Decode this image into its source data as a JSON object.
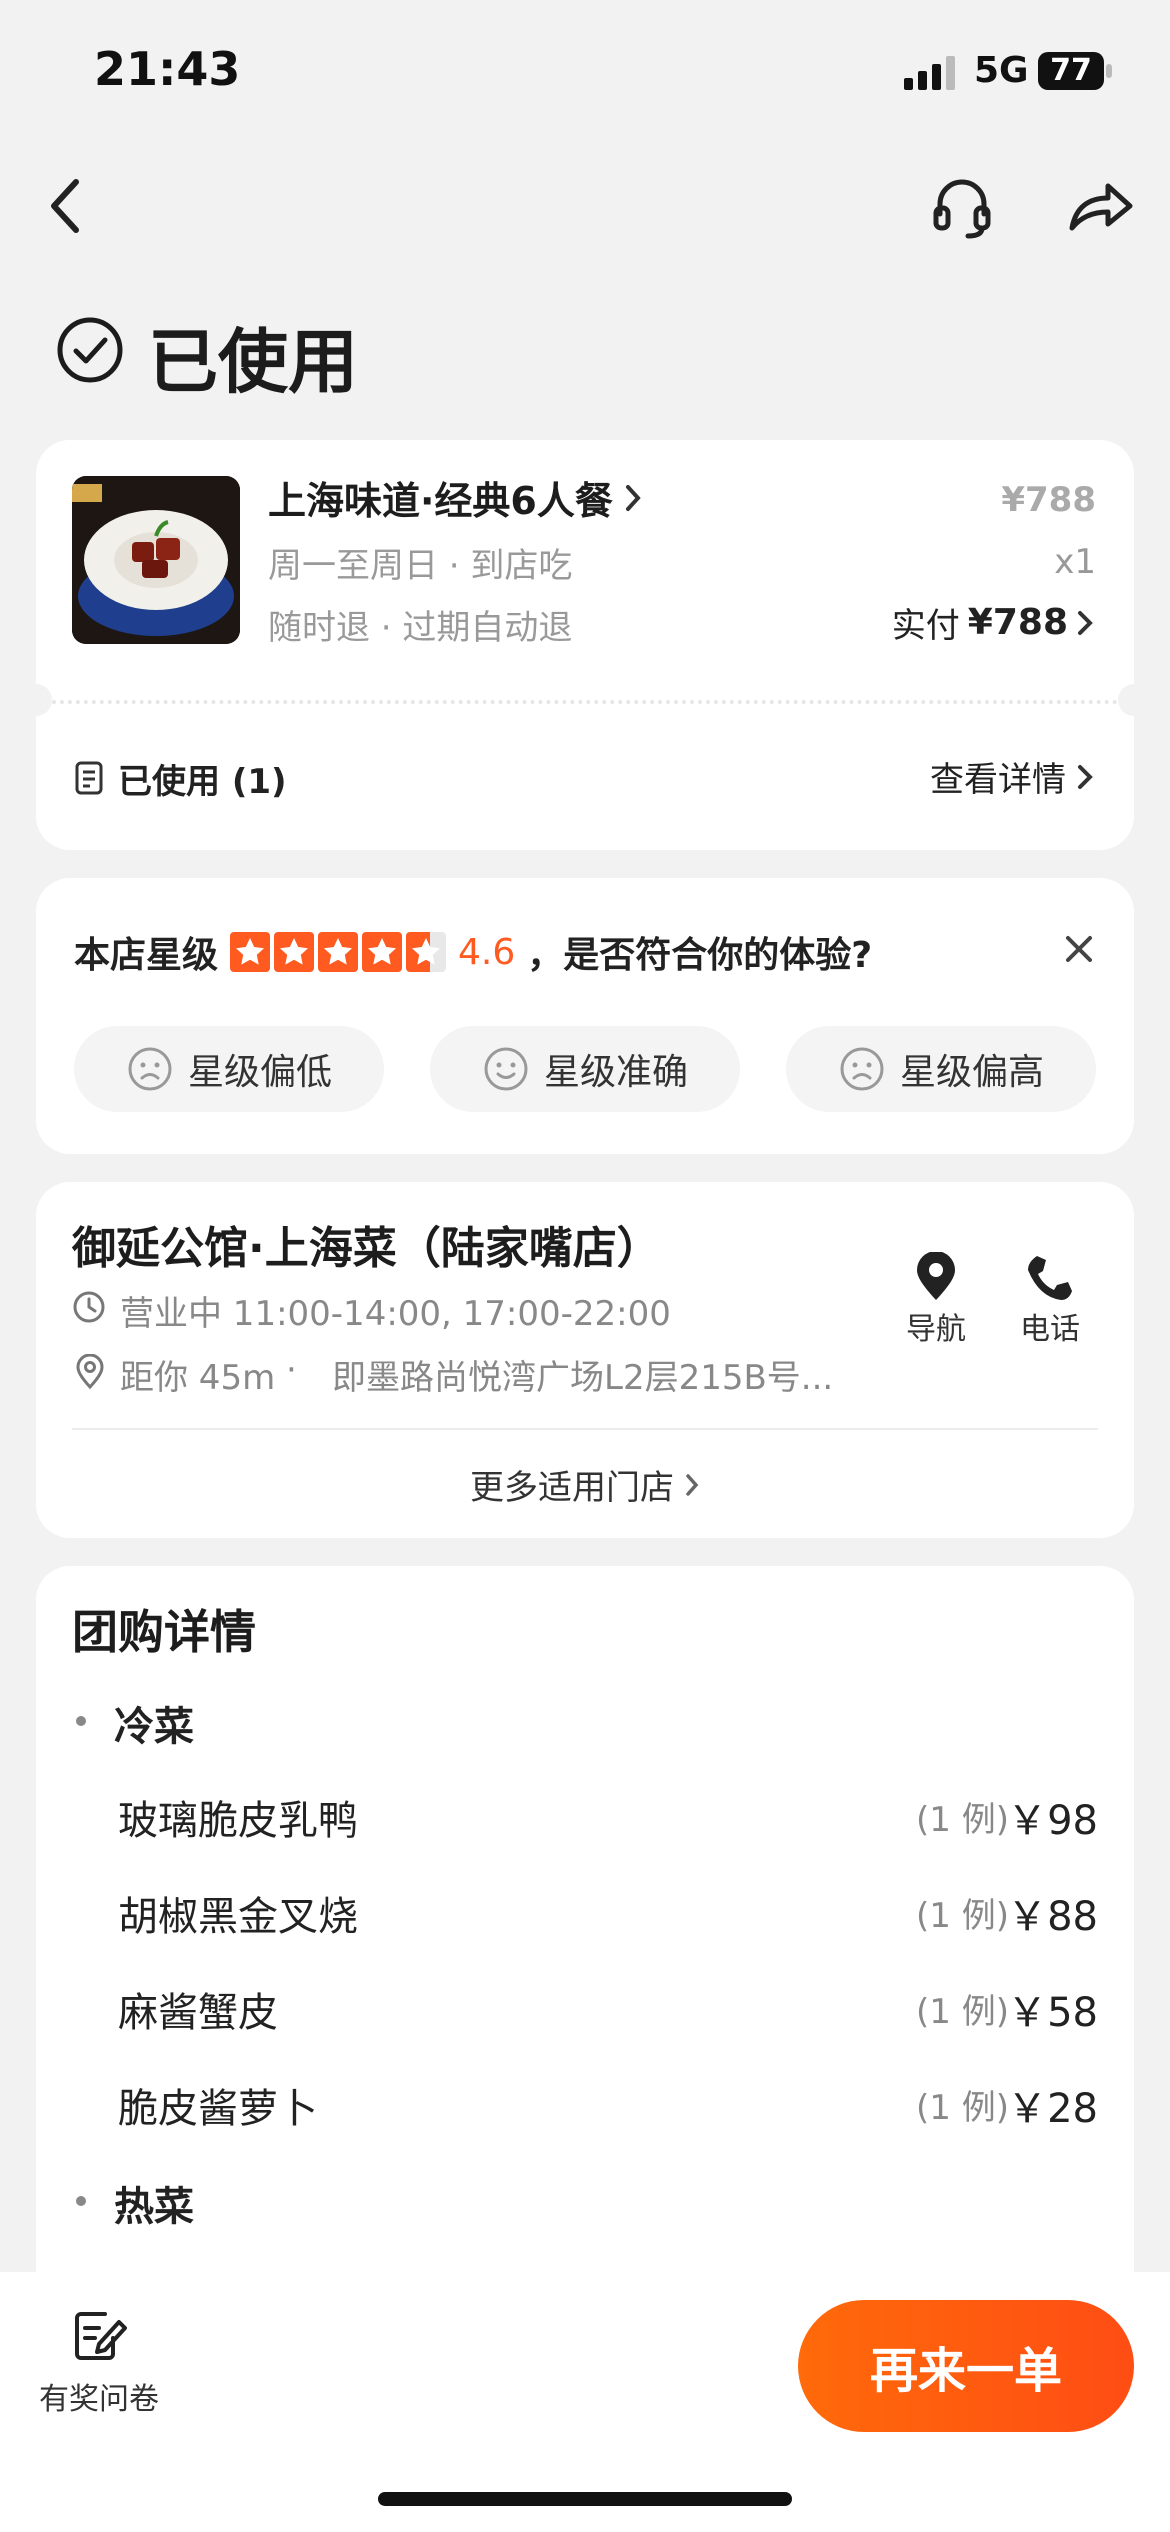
{
  "status_bar": {
    "time": "21:43",
    "network": "5G",
    "battery": "77"
  },
  "header": {
    "back_icon": "chevron-left-icon",
    "service_icon": "headset-icon",
    "share_icon": "share-icon"
  },
  "order_status": {
    "title": "已使用",
    "icon": "check-circle-icon"
  },
  "deal": {
    "name": "上海味道·经典6人餐",
    "subtitle1": "周一至周日 · 到店吃",
    "subtitle2": "随时退 · 过期自动退",
    "original_price": "¥788",
    "quantity": "x1",
    "paid_label": "实付",
    "paid_amount": "¥788",
    "used_label": "已使用 (1)",
    "details_link": "查看详情"
  },
  "rating": {
    "label": "本店星级",
    "score": "4.6",
    "stars": 4.6,
    "question": "，是否符合你的体验?",
    "options": [
      "星级偏低",
      "星级准确",
      "星级偏高"
    ],
    "star_color": "#ff5a1f"
  },
  "store": {
    "name": "御延公馆·上海菜（陆家嘴店）",
    "hours": "营业中 11:00-14:00, 17:00-22:00",
    "distance": "距你 45m",
    "address": "即墨路尚悦湾广场L2层215B号...",
    "nav_label": "导航",
    "phone_label": "电话",
    "more_stores": "更多适用门店"
  },
  "package": {
    "title": "团购详情",
    "sections": [
      {
        "name": "冷菜",
        "items": [
          {
            "name": "玻璃脆皮乳鸭",
            "qty": "(1 例)",
            "price": "￥98"
          },
          {
            "name": "胡椒黑金叉烧",
            "qty": "(1 例)",
            "price": "￥88"
          },
          {
            "name": "麻酱蟹皮",
            "qty": "(1 例)",
            "price": "￥58"
          },
          {
            "name": "脆皮酱萝卜",
            "qty": "(1 例)",
            "price": "￥28"
          }
        ]
      },
      {
        "name": "热菜",
        "items": []
      }
    ]
  },
  "bottom": {
    "survey_label": "有奖问卷",
    "reorder_label": "再来一单",
    "accent": "#ff5a14"
  }
}
